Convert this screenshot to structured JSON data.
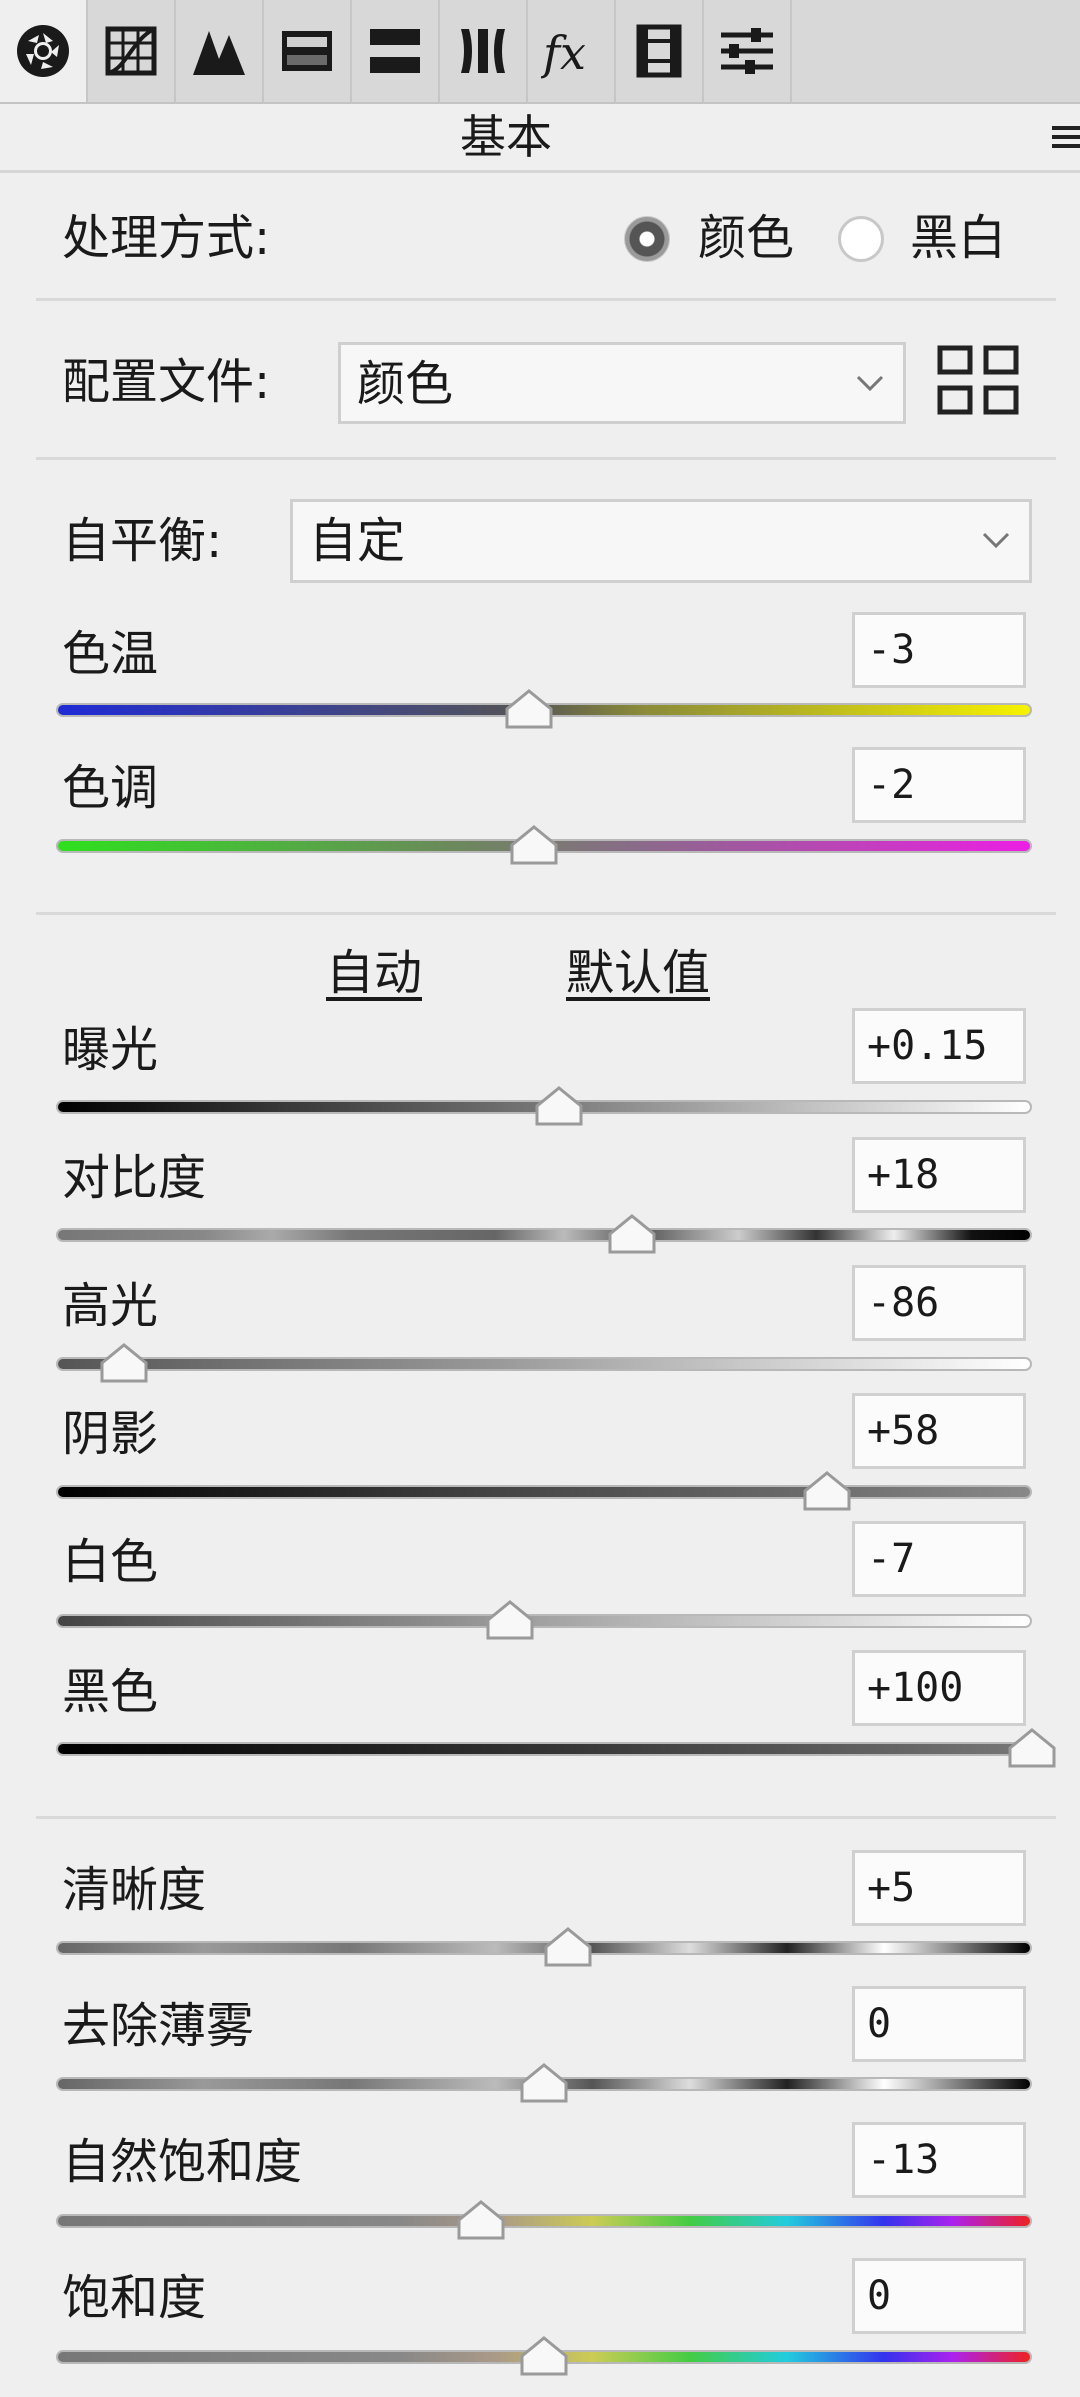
{
  "toolbar": {
    "tools": [
      {
        "icon": "aperture-icon",
        "active": true
      },
      {
        "icon": "tone-curve-icon",
        "active": false
      },
      {
        "icon": "detail-icon",
        "active": false
      },
      {
        "icon": "hsl-icon",
        "active": false
      },
      {
        "icon": "split-toning-icon",
        "active": false
      },
      {
        "icon": "lens-corrections-icon",
        "active": false
      },
      {
        "icon": "effects-icon",
        "active": false
      },
      {
        "icon": "calibration-icon",
        "active": false
      },
      {
        "icon": "presets-icon",
        "active": false
      }
    ],
    "effects_glyph": "fx"
  },
  "header": {
    "title": "基本"
  },
  "treatment": {
    "label": "处理方式:",
    "options": [
      {
        "label": "颜色",
        "selected": true
      },
      {
        "label": "黑白",
        "selected": false
      }
    ]
  },
  "profile": {
    "label": "配置文件:",
    "value": "颜色"
  },
  "white_balance": {
    "label": "自平衡:",
    "value": "自定",
    "sliders": [
      {
        "name": "temperature",
        "label": "色温",
        "value": "-3",
        "position": 0.485
      },
      {
        "name": "tint",
        "label": "色调",
        "value": "-2",
        "position": 0.49
      }
    ]
  },
  "tone": {
    "auto_label": "自动",
    "default_label": "默认值",
    "sliders": [
      {
        "name": "exposure",
        "label": "曝光",
        "value": "+0.15",
        "position": 0.515
      },
      {
        "name": "contrast",
        "label": "对比度",
        "value": "+18",
        "position": 0.59
      },
      {
        "name": "highlights",
        "label": "高光",
        "value": "-86",
        "position": 0.07
      },
      {
        "name": "shadows",
        "label": "阴影",
        "value": "+58",
        "position": 0.79
      },
      {
        "name": "whites",
        "label": "白色",
        "value": "-7",
        "position": 0.465
      },
      {
        "name": "blacks",
        "label": "黑色",
        "value": "+100",
        "position": 1.0
      }
    ]
  },
  "presence": {
    "sliders": [
      {
        "name": "clarity",
        "label": "清晰度",
        "value": "+5",
        "position": 0.525
      },
      {
        "name": "dehaze",
        "label": "去除薄雾",
        "value": "0",
        "position": 0.5
      },
      {
        "name": "vibrance",
        "label": "自然饱和度",
        "value": "-13",
        "position": 0.435
      },
      {
        "name": "saturation",
        "label": "饱和度",
        "value": "0",
        "position": 0.5
      }
    ]
  }
}
